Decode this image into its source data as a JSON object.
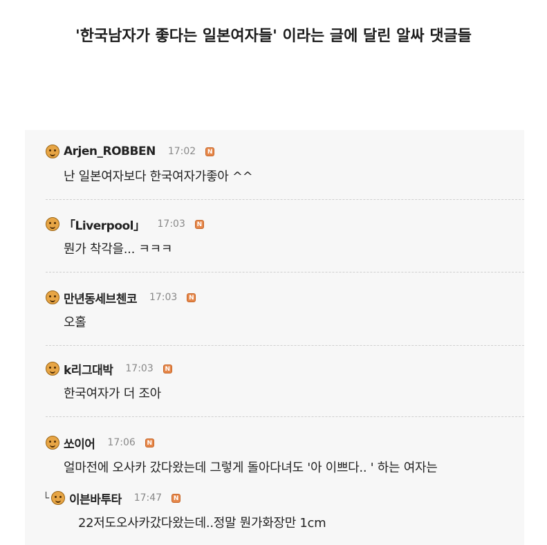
{
  "post": {
    "title": "'한국남자가 좋다는 일본여자들' 이라는 글에 달린 알싸 댓글들"
  },
  "comments": [
    {
      "nick": "Arjen_ROBBEN",
      "time": "17:02",
      "badge": "N",
      "text": "난 일본여자보다 한국여자가좋아 ^^"
    },
    {
      "nick": "「Liverpool」",
      "time": "17:03",
      "badge": "N",
      "text": "뭔가 착각을... ㅋㅋㅋ"
    },
    {
      "nick": "만년동세브첸코",
      "time": "17:03",
      "badge": "N",
      "text": "오홀"
    },
    {
      "nick": "k리그대박",
      "time": "17:03",
      "badge": "N",
      "text": "한국여자가 더 조아"
    },
    {
      "nick": "쏘이어",
      "time": "17:06",
      "badge": "N",
      "text": "얼마전에 오사카 갔다왔는데 그렇게 돌아다녀도 '아 이쁘다.. ' 하는 여자는"
    }
  ],
  "reply": {
    "arrow": "└",
    "nick": "이븐바투타",
    "time": "17:47",
    "badge": "N",
    "text": "22저도오사카갔다왔는데..정말 뭔가화장만 1cm"
  },
  "colors": {
    "panel_bg": "#f7f7f7",
    "badge": "#e6874a",
    "avatar": "#e7a545",
    "time": "#888888"
  }
}
